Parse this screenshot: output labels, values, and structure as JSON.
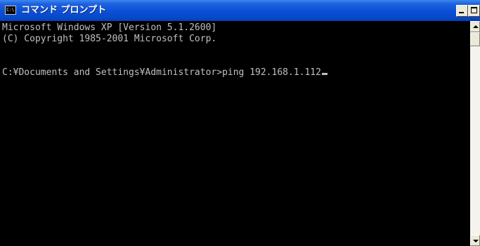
{
  "window": {
    "title": "コマンド プロンプト",
    "icon_text": "C:\\"
  },
  "console": {
    "lines": [
      "Microsoft Windows XP [Version 5.1.2600]",
      "(C) Copyright 1985-2001 Microsoft Corp.",
      "",
      "C:¥Documents and Settings¥Administrator>ping 192.168.1.112"
    ]
  },
  "colors": {
    "titlebar": "#0a4fd6",
    "console_bg": "#000000",
    "console_text": "#c0c0c0"
  },
  "icons": {
    "app": "console-icon",
    "minimize": "minimize-icon",
    "maximize": "maximize-icon",
    "close": "close-icon",
    "scroll_up": "arrow-up-icon",
    "scroll_down": "arrow-down-icon"
  }
}
